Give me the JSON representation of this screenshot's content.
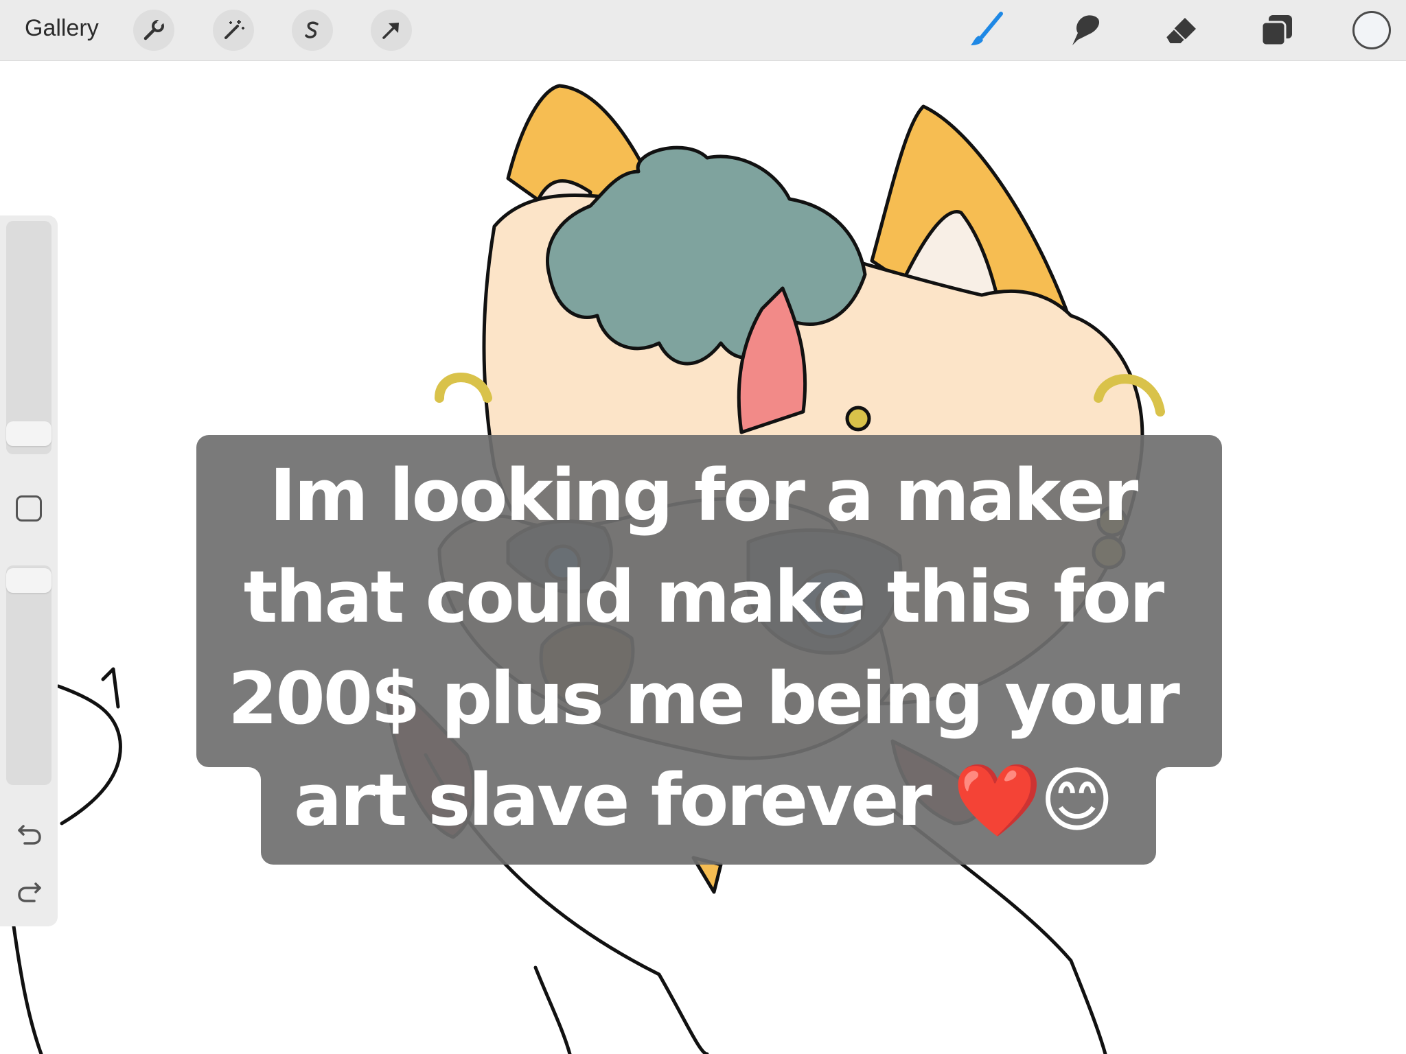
{
  "topbar": {
    "gallery_label": "Gallery",
    "actions": [
      "wrench-icon",
      "magic-wand-icon",
      "selection-s-icon",
      "transform-arrow-icon"
    ],
    "tools": [
      "brush-icon",
      "smudge-icon",
      "eraser-icon",
      "layers-icon"
    ],
    "active_tool": "brush-icon",
    "brush_color": "#1e88e5",
    "current_color": "#f2f4f7"
  },
  "sidebar": {
    "buttons": [
      "modify-square-button",
      "undo-icon",
      "redo-icon"
    ]
  },
  "caption": {
    "line1": "Im looking for a maker",
    "line2": "that could make this for",
    "line3": "200$ plus me being your",
    "line4": "art slave forever",
    "emoji": "❤️😊"
  },
  "colors": {
    "ear_yellow": "#f6bd52",
    "fur_cream": "#fce4c8",
    "hair_teal": "#7fa39e",
    "nose_brown": "#7a5a2a",
    "mouth_red": "#9b3f3f",
    "caption_bg": "#6f6f6f"
  }
}
